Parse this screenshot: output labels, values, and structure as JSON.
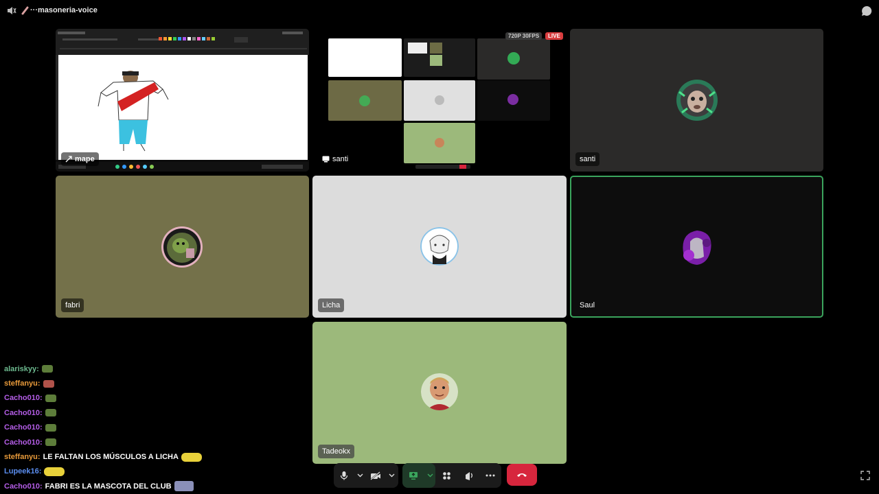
{
  "window": {
    "channel_title": "···masoneria-voice"
  },
  "colors": {
    "accent_green": "#3ba55d",
    "leave_red": "#d7263d",
    "live_red": "#d83c3e"
  },
  "stream_mape": {
    "name": "mape"
  },
  "stream_santi": {
    "name": "santi",
    "quality_badge": "720P 30FPS",
    "live_badge": "LIVE"
  },
  "tiles": [
    {
      "name": "santi",
      "bg": "#2b2a29"
    },
    {
      "name": "fabri",
      "bg": "#74714a"
    },
    {
      "name": "Licha",
      "bg": "#dcdcdc"
    },
    {
      "name": "Saul",
      "bg": "#0d0d0d"
    },
    {
      "name": "Tadeokx",
      "bg": "#9cb97b"
    }
  ],
  "chat": {
    "messages": [
      {
        "user": "alariskyy:",
        "color": "#6dba8f",
        "text": "",
        "emote_color": "#5d7d3a"
      },
      {
        "user": "steffanyu:",
        "color": "#e89a3a",
        "text": "",
        "emote_color": "#b0524a"
      },
      {
        "user": "Cacho010:",
        "color": "#b55ee8",
        "text": "",
        "emote_color": "#5d7d3a"
      },
      {
        "user": "Cacho010:",
        "color": "#b55ee8",
        "text": "",
        "emote_color": "#5d7d3a"
      },
      {
        "user": "Cacho010:",
        "color": "#b55ee8",
        "text": "",
        "emote_color": "#5d7d3a"
      },
      {
        "user": "Cacho010:",
        "color": "#b55ee8",
        "text": "",
        "emote_color": "#5d7d3a"
      },
      {
        "user": "steffanyu:",
        "color": "#e89a3a",
        "text": "LE FALTAN LOS MÚSCULOS A LICHA",
        "emote_color": "#e8d13a"
      },
      {
        "user": "Lupeek16:",
        "color": "#5b8ef0",
        "text": "",
        "emote_color": "#e8d13a"
      },
      {
        "user": "Cacho010:",
        "color": "#b55ee8",
        "text": "FABRI ES LA MASCOTA DEL CLUB",
        "emote_color": "#8a8fb8"
      }
    ]
  },
  "controls": {
    "icons": [
      "microphone-icon",
      "chevron-down-icon",
      "camera-off-icon",
      "chevron-down-icon",
      "screen-share-icon",
      "chevron-down-icon",
      "activities-icon",
      "soundboard-icon",
      "more-icon",
      "leave-call-icon",
      "fullscreen-icon"
    ]
  }
}
